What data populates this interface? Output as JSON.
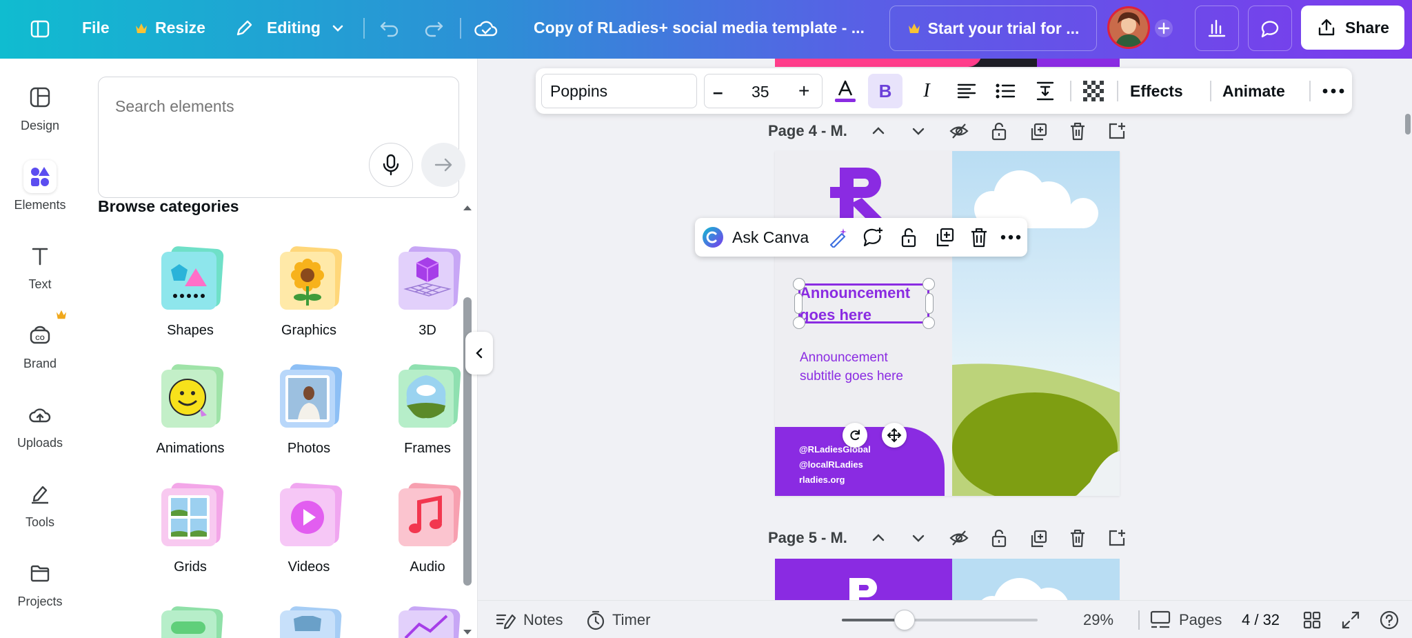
{
  "topbar": {
    "file": "File",
    "resize": "Resize",
    "editing": "Editing",
    "doc_title": "Copy of RLadies+ social media template - ...",
    "trial": "Start your trial for ...",
    "share": "Share"
  },
  "rail": {
    "items": [
      {
        "label": "Design",
        "icon": "design-icon"
      },
      {
        "label": "Elements",
        "icon": "elements-icon"
      },
      {
        "label": "Text",
        "icon": "text-icon"
      },
      {
        "label": "Brand",
        "icon": "brand-icon"
      },
      {
        "label": "Uploads",
        "icon": "uploads-icon"
      },
      {
        "label": "Tools",
        "icon": "tools-icon"
      },
      {
        "label": "Projects",
        "icon": "projects-icon"
      }
    ]
  },
  "panel": {
    "search_placeholder": "Search elements",
    "browse": "Browse categories",
    "categories": [
      "Shapes",
      "Graphics",
      "3D",
      "Animations",
      "Photos",
      "Frames",
      "Grids",
      "Videos",
      "Audio"
    ]
  },
  "toolbar": {
    "font": "Poppins",
    "font_size": "35",
    "minus": "–",
    "plus": "+",
    "bold": "B",
    "italic": "I",
    "effects": "Effects",
    "animate": "Animate"
  },
  "pages": {
    "page4": "Page 4 - M.",
    "page5": "Page 5 - M."
  },
  "design": {
    "announcement": "Announcement goes here",
    "subtitle": "Announcement subtitle goes here",
    "handle1": "@RLadiesGlobal",
    "handle2": "@localRLadies",
    "site": "rladies.org"
  },
  "context_menu": {
    "ask_canva": "Ask Canva"
  },
  "bottom": {
    "notes": "Notes",
    "timer": "Timer",
    "zoom": "29%",
    "pages_label": "Pages",
    "page_count": "4 / 32",
    "zoom_level": 0.29
  },
  "colors": {
    "accent": "#7c3aed",
    "brand_purple": "#8a2be2",
    "teal": "#10bcd0"
  }
}
